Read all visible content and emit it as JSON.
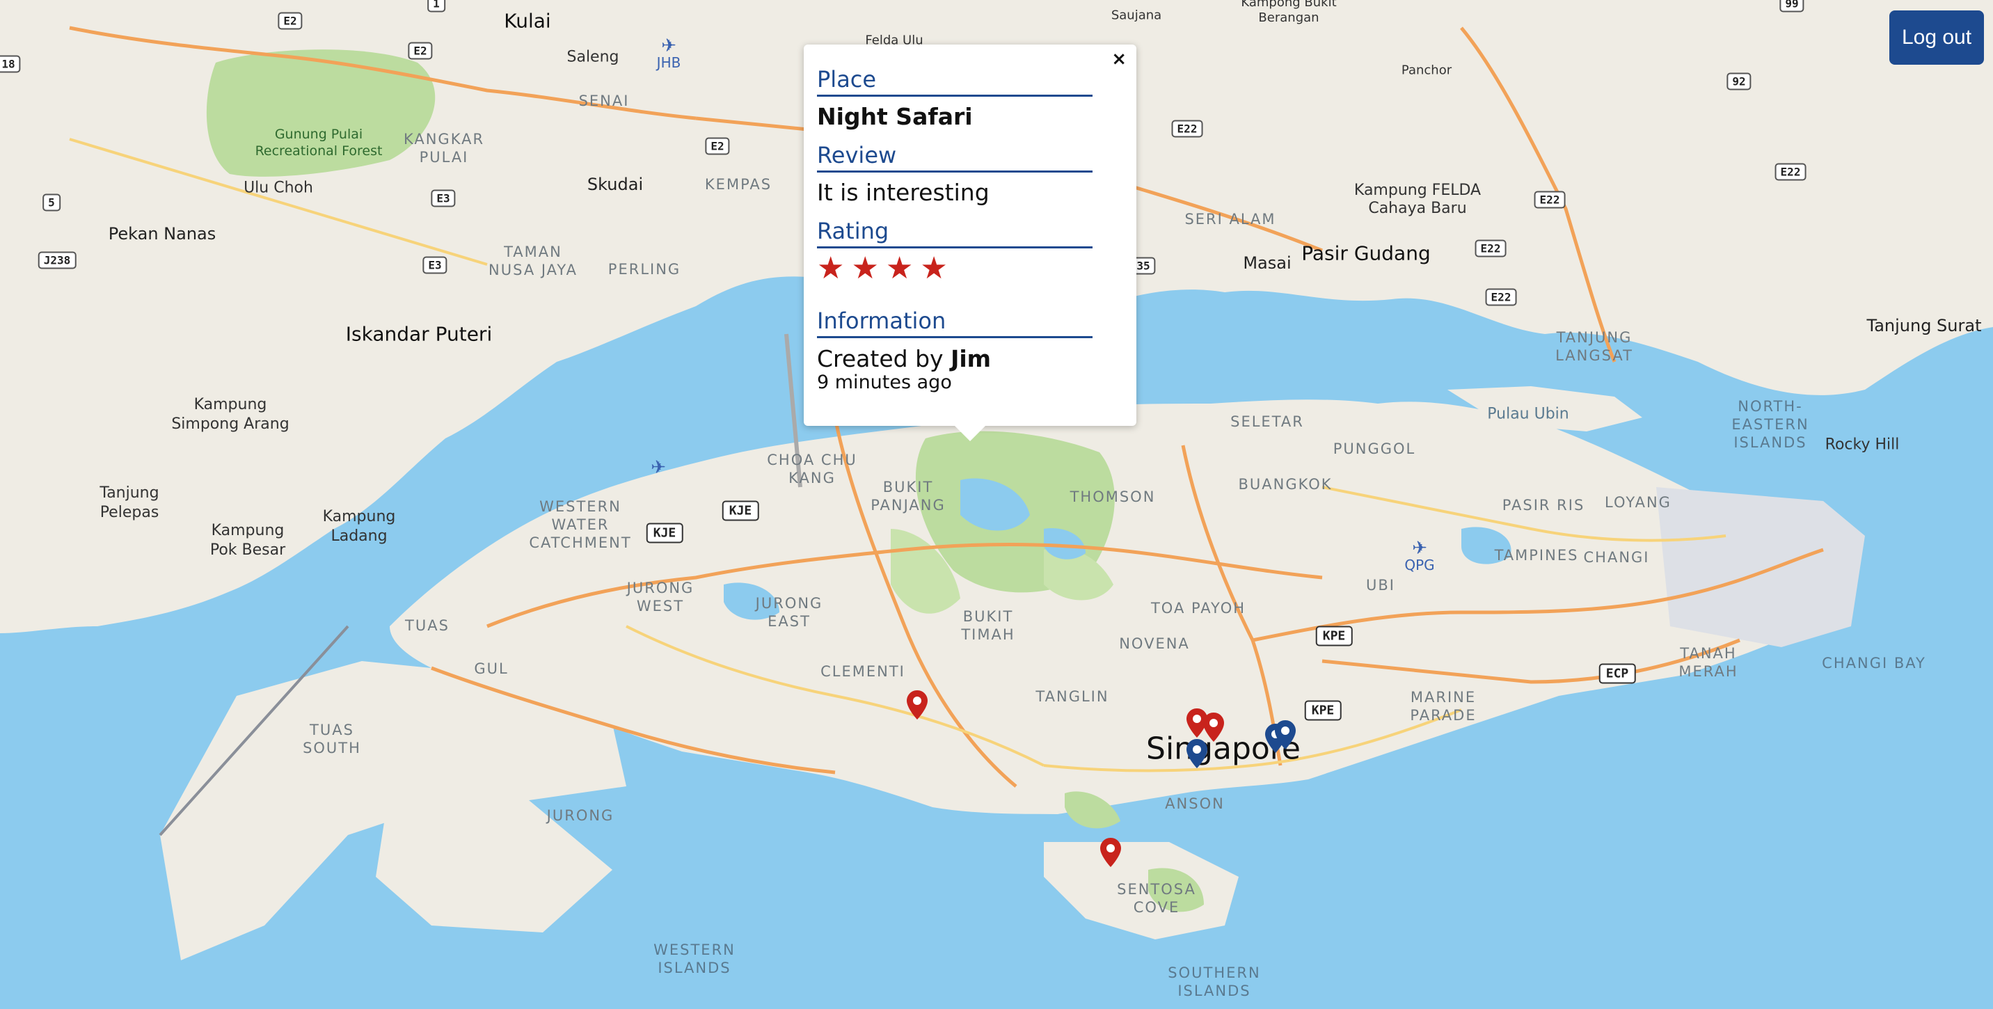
{
  "header": {
    "logout_label": "Log out"
  },
  "popup": {
    "close_label": "×",
    "place_heading": "Place",
    "place_value": "Night Safari",
    "review_heading": "Review",
    "review_value": "It is interesting",
    "rating_heading": "Rating",
    "rating_value": 4,
    "stars": [
      "★",
      "★",
      "★",
      "★"
    ],
    "info_heading": "Information",
    "created_prefix": "Created by",
    "created_by": "Jim",
    "time_ago": "9 minutes ago"
  },
  "map": {
    "labels": {
      "kulai": "Kulai",
      "saleng": "Saleng",
      "senai": "SENAI",
      "felda_ulu": "Felda Ulu",
      "saujana": "Saujana",
      "kampong_bukit_berangan": "Kampong Bukit\nBerangan",
      "panchor": "Panchor",
      "gunung_pulai": "Gunung Pulai\nRecreational Forest",
      "kangkar_pulai": "KANGKAR\nPULAI",
      "skudai": "Skudai",
      "kempas": "KEMPAS",
      "ulu_choh": "Ulu Choh",
      "pekan_nanas": "Pekan Nanas",
      "taman_nusa_jaya": "TAMAN\nNUSA JAYA",
      "perling": "PERLING",
      "iskandar_puteri": "Iskandar Puteri",
      "seri_alam": "SERI ALAM",
      "masai": "Masai",
      "pasir_gudang": "Pasir Gudang",
      "kampung_felda": "Kampung FELDA\nCahaya Baru",
      "tanjung_langsat": "TANJUNG\nLANGSAT",
      "tanjung_surat": "Tanjung Surat",
      "seletar": "SELETAR",
      "punggol": "PUNGGOL",
      "pulau_ubin": "Pulau Ubin",
      "north_eastern_islands": "NORTH-\nEASTERN\nISLANDS",
      "rocky_hill": "Rocky Hill",
      "kampung_simpong_arang": "Kampung\nSimpong Arang",
      "tanjung_pelepas": "Tanjung\nPelepas",
      "kampung_pok_besar": "Kampung\nPok Besar",
      "kampung_ladang": "Kampung\nLadang",
      "choa_chu_kang": "CHOA CHU\nKANG",
      "bukit_panjang": "BUKIT\nPANJANG",
      "thomson": "THOMSON",
      "buangkok": "BUANGKOK",
      "pasir_ris": "PASIR RIS",
      "loyang": "LOYANG",
      "western_water_catchment": "WESTERN\nWATER\nCATCHMENT",
      "tampines": "TAMPINES",
      "changi": "CHANGI",
      "jurong_west": "JURONG\nWEST",
      "jurong_east": "JURONG\nEAST",
      "bukit_timah": "BUKIT\nTIMAH",
      "toa_payoh": "TOA PAYOH",
      "ubi": "UBI",
      "novena": "NOVENA",
      "tuas": "TUAS",
      "gul": "GUL",
      "clementi": "CLEMENTI",
      "tanglin": "TANGLIN",
      "singapore": "Singapore",
      "marine_parade": "MARINE\nPARADE",
      "tanah_merah": "TANAH\nMERAH",
      "changi_bay": "CHANGI BAY",
      "tuas_south": "TUAS\nSOUTH",
      "jurong": "JURONG",
      "anson": "ANSON",
      "sentosa_cove": "SENTOSA\nCOVE",
      "western_islands": "WESTERN\nISLANDS",
      "southern_islands": "SOUTHERN\nISLANDS"
    },
    "roads": {
      "e2_a": "E2",
      "e2_b": "E2",
      "e2_c": "E2",
      "e3_a": "E3",
      "e3_b": "E3",
      "r1": "1",
      "r5": "5",
      "j238": "J238",
      "r18": "18",
      "r92": "92",
      "r99": "99",
      "e22_a": "E22",
      "e22_b": "E22",
      "e22_c": "E22",
      "e22_d": "E22",
      "e22_e": "E22",
      "r35": "35",
      "kje_a": "KJE",
      "kje_b": "KJE",
      "kpe_a": "KPE",
      "kpe_b": "KPE",
      "ecp": "ECP"
    },
    "airports": {
      "jhb": "JHB",
      "qpg": "QPG"
    },
    "plane_icon": "✈",
    "marker_colors": {
      "red": "#c8231c",
      "blue": "#1d4a8f"
    },
    "markers": [
      {
        "color": "red",
        "kind": "place-marker"
      },
      {
        "color": "red",
        "kind": "place-marker"
      },
      {
        "color": "red",
        "kind": "place-marker"
      },
      {
        "color": "red",
        "kind": "place-marker"
      },
      {
        "color": "blue",
        "kind": "place-marker"
      },
      {
        "color": "blue",
        "kind": "place-marker"
      },
      {
        "color": "blue",
        "kind": "place-marker"
      }
    ]
  }
}
